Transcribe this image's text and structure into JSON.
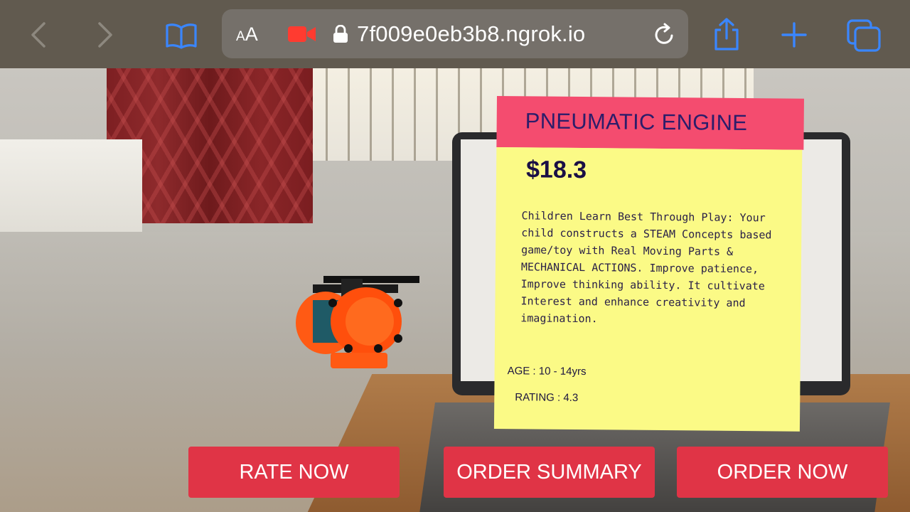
{
  "browser": {
    "text_size_small": "A",
    "text_size_big": "A",
    "url": "7f009e0eb3b8.ngrok.io",
    "accent": "#3a86ff",
    "camera_indicator_color": "#ff3b30"
  },
  "product": {
    "title": "PNEUMATIC ENGINE",
    "price": "$18.3",
    "description": "Children Learn Best Through Play: Your child constructs a STEAM Concepts based game/toy with Real Moving Parts & MECHANICAL ACTIONS. Improve patience, Improve thinking ability. It cultivate Interest and enhance creativity and imagination.",
    "age": "AGE : 10 - 14yrs",
    "rating": "RATING : 4.3",
    "header_color": "#f44c6f",
    "card_color": "#fbfa86"
  },
  "actions": {
    "rate_now": "RATE NOW",
    "order_summary": "ORDER SUMMARY",
    "order_now": "ORDER NOW",
    "button_color": "#e03446"
  }
}
